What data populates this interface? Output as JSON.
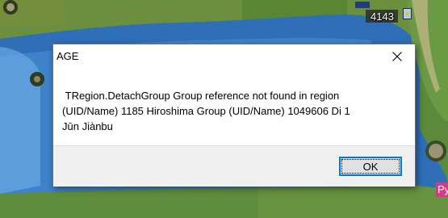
{
  "map": {
    "unit_count": "4143",
    "unit_badge": "★",
    "region_label": "Py"
  },
  "dialog": {
    "title": "AGE",
    "message": " TRegion.DetachGroup Group reference not found in region\n(UID/Name) 1185 Hiroshima Group (UID/Name) 1049606 Di 1\nJūn Jiànbu",
    "ok_label": "OK",
    "close_icon": "close-icon"
  },
  "colors": {
    "dialog_accent": "#0078d7",
    "sea": "#3a80c6",
    "land": "#5e8a3c",
    "region_label_bg": "#d63a84"
  }
}
